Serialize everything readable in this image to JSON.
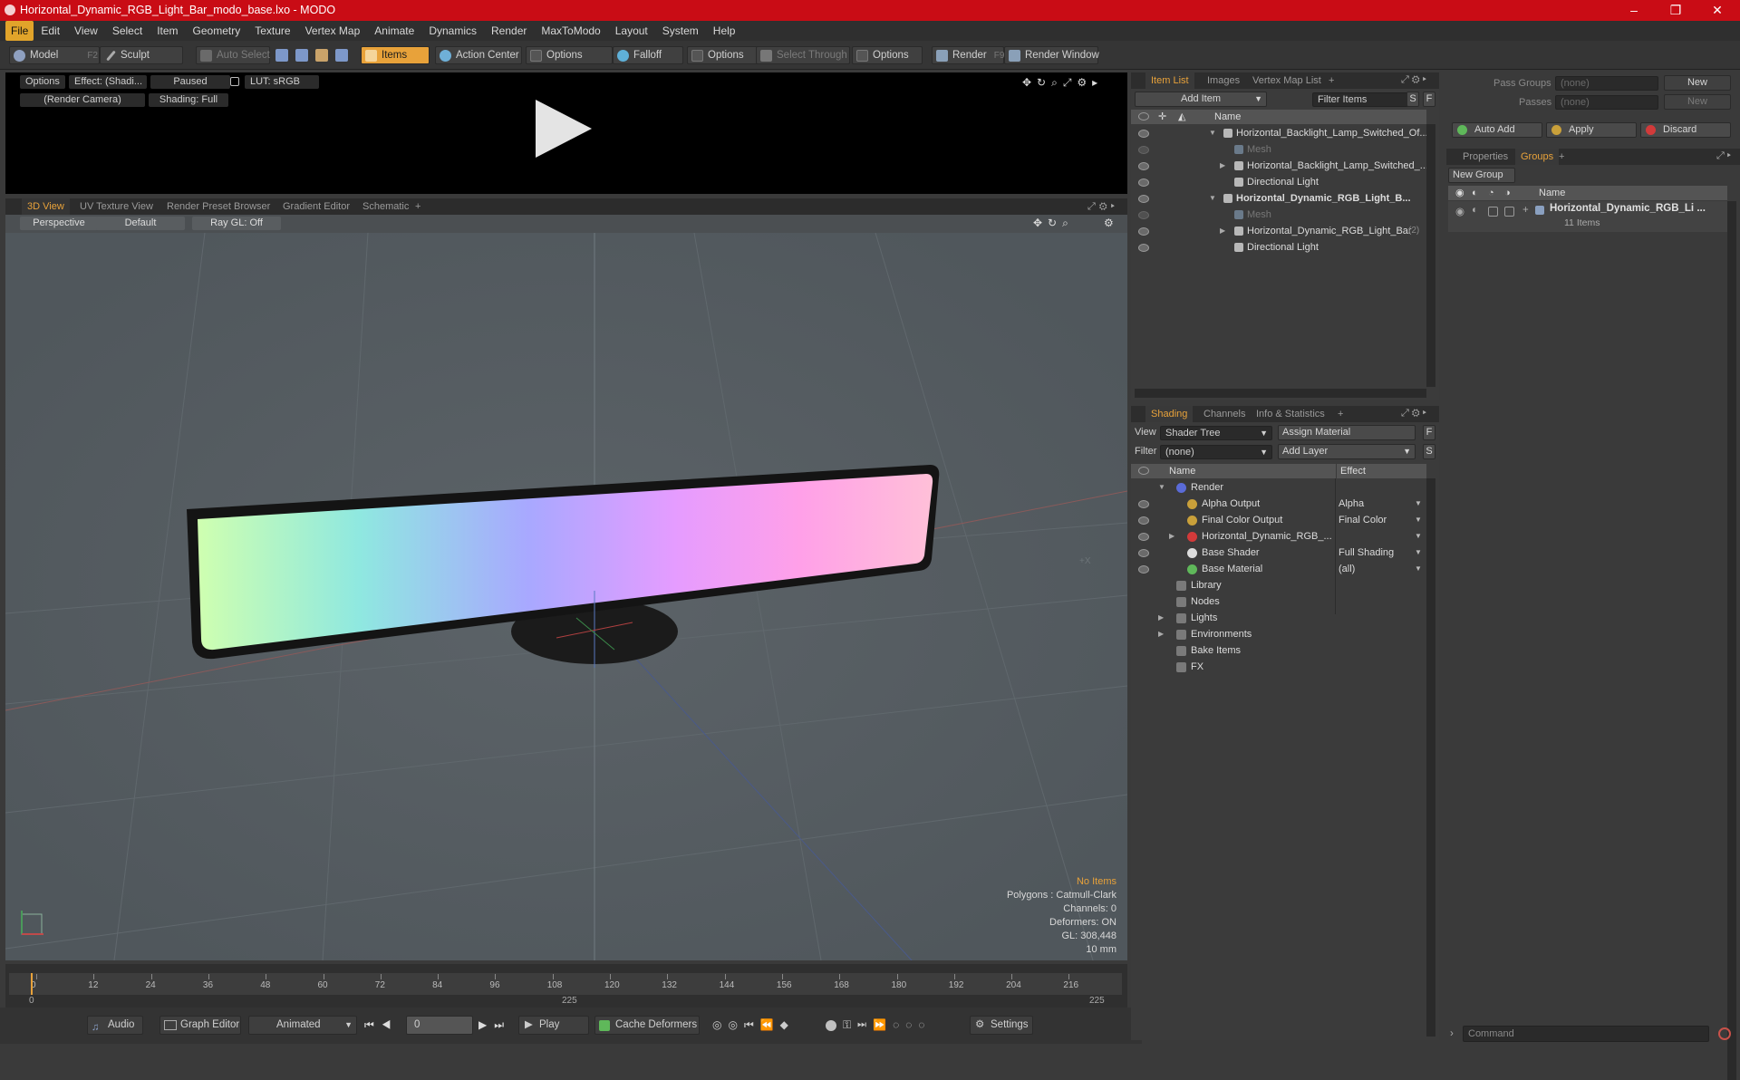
{
  "title": "Horizontal_Dynamic_RGB_Light_Bar_modo_base.lxo - MODO",
  "window_controls": {
    "minimize": "–",
    "restore": "❐",
    "close": "✕"
  },
  "menu": [
    "File",
    "Edit",
    "View",
    "Select",
    "Item",
    "Geometry",
    "Texture",
    "Vertex Map",
    "Animate",
    "Dynamics",
    "Render",
    "MaxToModo",
    "Layout",
    "System",
    "Help"
  ],
  "toolbar": {
    "model": "Model",
    "model_key": "F2",
    "sculpt": "Sculpt",
    "auto_select": "Auto Select",
    "items": "Items",
    "action_center": "Action Center",
    "options1": "Options",
    "falloff": "Falloff",
    "options2": "Options",
    "select_through": "Select Through",
    "options3": "Options",
    "render": "Render",
    "render_key": "F9",
    "render_window": "Render Window"
  },
  "render_preview": {
    "options": "Options",
    "effect": "Effect: (Shadi...",
    "paused": "Paused",
    "lut": "LUT: sRGB",
    "camera": "(Render Camera)",
    "shading": "Shading: Full"
  },
  "view_tabs": [
    "3D View",
    "UV Texture View",
    "Render Preset Browser",
    "Gradient Editor",
    "Schematic",
    "+"
  ],
  "viewport_bar": {
    "projection": "Perspective",
    "style": "Default",
    "raygl": "Ray GL: Off"
  },
  "stats": {
    "no_items": "No Items",
    "polygons": "Polygons : Catmull-Clark",
    "channels": "Channels: 0",
    "deformers": "Deformers: ON",
    "gl": "GL: 308,448",
    "unit": "10 mm"
  },
  "timeline": {
    "ticks": [
      "0",
      "12",
      "24",
      "36",
      "48",
      "60",
      "72",
      "84",
      "96",
      "108",
      "120",
      "132",
      "144",
      "156",
      "168",
      "180",
      "192",
      "204",
      "216"
    ],
    "start": "0",
    "mid": "225",
    "end": "225"
  },
  "bottom": {
    "audio": "Audio",
    "graph_editor": "Graph Editor",
    "animated": "Animated",
    "frame": "0",
    "play": "Play",
    "cache_deformers": "Cache Deformers",
    "settings": "Settings"
  },
  "item_list": {
    "tabs": [
      "Item List",
      "Images",
      "Vertex Map List",
      "+"
    ],
    "add_item": "Add Item",
    "filter_items": "Filter Items",
    "s": "S",
    "f": "F",
    "col_name": "Name",
    "rows": [
      {
        "label": "Horizontal_Backlight_Lamp_Switched_Of...",
        "indent": 0,
        "bold": false,
        "dim": false,
        "expand": "▼"
      },
      {
        "label": "Mesh",
        "indent": 1,
        "bold": false,
        "dim": true,
        "expand": ""
      },
      {
        "label": "Horizontal_Backlight_Lamp_Switched_...",
        "indent": 1,
        "bold": false,
        "dim": false,
        "expand": "▶"
      },
      {
        "label": "Directional Light",
        "indent": 1,
        "bold": false,
        "dim": false,
        "expand": ""
      },
      {
        "label": "Horizontal_Dynamic_RGB_Light_B...",
        "indent": 0,
        "bold": true,
        "dim": false,
        "expand": "▼"
      },
      {
        "label": "Mesh",
        "indent": 1,
        "bold": false,
        "dim": true,
        "expand": ""
      },
      {
        "label": "Horizontal_Dynamic_RGB_Light_Bar",
        "indent": 1,
        "bold": false,
        "dim": false,
        "expand": "▶",
        "suffix": "(2)"
      },
      {
        "label": "Directional Light",
        "indent": 1,
        "bold": false,
        "dim": false,
        "expand": ""
      }
    ]
  },
  "shading": {
    "tabs": [
      "Shading",
      "Channels",
      "Info & Statistics",
      "+"
    ],
    "view_label": "View",
    "view_value": "Shader Tree",
    "assign_material": "Assign Material",
    "f": "F",
    "filter_label": "Filter",
    "filter_value": "(none)",
    "add_layer": "Add Layer",
    "s": "S",
    "col_name": "Name",
    "col_effect": "Effect",
    "rows": [
      {
        "label": "Render",
        "effect": "",
        "indent": 0,
        "expand": "▼",
        "icon": "#5a6bd8"
      },
      {
        "label": "Alpha Output",
        "effect": "Alpha",
        "indent": 1,
        "expand": "",
        "icon": "#c9a03a"
      },
      {
        "label": "Final Color Output",
        "effect": "Final Color",
        "indent": 1,
        "expand": "",
        "icon": "#c9a03a"
      },
      {
        "label": "Horizontal_Dynamic_RGB_...",
        "effect": "",
        "indent": 1,
        "expand": "▶",
        "icon": "#d23a3a"
      },
      {
        "label": "Base Shader",
        "effect": "Full Shading",
        "indent": 1,
        "expand": "",
        "icon": "#dcdcdc"
      },
      {
        "label": "Base Material",
        "effect": "(all)",
        "indent": 1,
        "expand": "",
        "icon": "#5fb85a"
      },
      {
        "label": "Library",
        "effect": "",
        "indent": 0,
        "expand": "",
        "icon": ""
      },
      {
        "label": "Nodes",
        "effect": "",
        "indent": 0,
        "expand": "",
        "icon": ""
      },
      {
        "label": "Lights",
        "effect": "",
        "indent": 0,
        "expand": "▶",
        "icon": ""
      },
      {
        "label": "Environments",
        "effect": "",
        "indent": 0,
        "expand": "▶",
        "icon": ""
      },
      {
        "label": "Bake Items",
        "effect": "",
        "indent": 0,
        "expand": "",
        "icon": ""
      },
      {
        "label": "FX",
        "effect": "",
        "indent": 0,
        "expand": "",
        "icon": ""
      }
    ]
  },
  "right_panel": {
    "pass_groups_label": "Pass Groups",
    "pass_groups_value": "(none)",
    "new": "New",
    "passes_label": "Passes",
    "passes_value": "(none)",
    "new2": "New",
    "auto_add": "Auto Add",
    "apply": "Apply",
    "discard": "Discard",
    "tabs": [
      "Properties",
      "Groups",
      "+"
    ],
    "new_group": "New Group",
    "col_name": "Name",
    "group_name": "Horizontal_Dynamic_RGB_Li ...",
    "group_count": "11 Items"
  },
  "command_placeholder": "Command",
  "colors": {
    "accent": "#e8a23a",
    "titlebar": "#c90c15"
  }
}
